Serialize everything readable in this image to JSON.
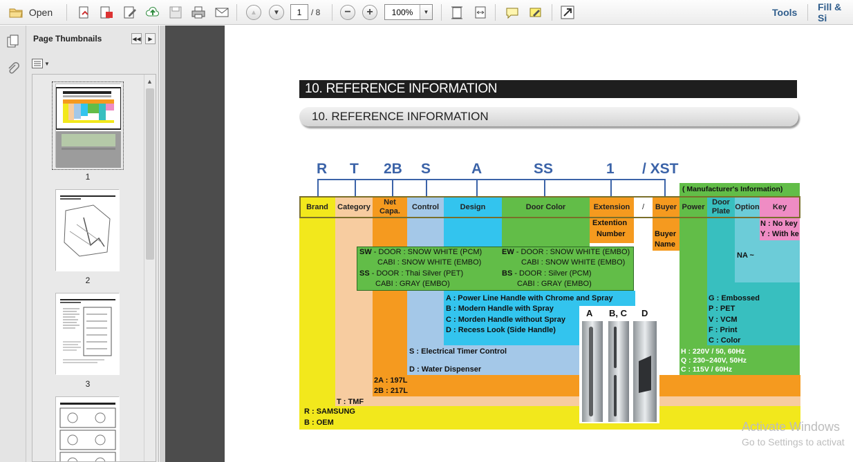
{
  "toolbar": {
    "open_label": "Open",
    "page_current": "1",
    "page_total": "/ 8",
    "zoom": "100%",
    "tools_label": "Tools",
    "fill_sign_label": "Fill & Si"
  },
  "sidebar": {
    "title": "Page Thumbnails",
    "thumbnails": [
      "1",
      "2",
      "3"
    ]
  },
  "document": {
    "band_title": "10. REFERENCE INFORMATION",
    "pill_title": "10. REFERENCE INFORMATION",
    "model_code": [
      "R",
      "T",
      "2B",
      "S",
      "A",
      "SS",
      "1",
      "/ XST"
    ],
    "manufacturer_info": "( Manufacturer's Information)",
    "headers": {
      "brand": "Brand",
      "category": "Category",
      "net_capa_1": "Net",
      "net_capa_2": "Capa.",
      "control": "Control",
      "design": "Design",
      "door_color": "Door Color",
      "extension": "Extension",
      "slash": "/",
      "buyer": "Buyer",
      "power": "Power",
      "door_plate_1": "Door",
      "door_plate_2": "Plate",
      "option": "Option",
      "key": "Key"
    },
    "extension_number": [
      "Extention",
      "Number"
    ],
    "buyer_name": [
      "Buyer",
      "Name"
    ],
    "key_values": [
      "N : No key",
      "Y : With ke"
    ],
    "option_value": "NA ~",
    "door_color_lines": [
      {
        "code": "SW",
        "text": " - DOOR : SNOW WHITE (PCM)"
      },
      {
        "code": "",
        "text": "CABI : SNOW WHITE (EMBO)"
      },
      {
        "code": "SS",
        "text": " - DOOR : Thai Silver (PET)"
      },
      {
        "code": "",
        "text": "CABI : GRAY (EMBO)"
      },
      {
        "code": "EW",
        "text": " - DOOR : SNOW WHITE (EMBO)"
      },
      {
        "code": "",
        "text": "CABI : SNOW WHITE (EMBO)"
      },
      {
        "code": "BS",
        "text": " - DOOR : Silver (PCM)"
      },
      {
        "code": "",
        "text": "CABI : GRAY (EMBO)"
      }
    ],
    "design_values": [
      "A : Power Line Handle with Chrome and Spray",
      "B : Modern Handle with Spray",
      "C : Morden Handle without Spray",
      "D : Recess Look (Side Handle)"
    ],
    "handle_labels": [
      "A",
      "B, C",
      "D"
    ],
    "control_values": [
      "S : Electrical Timer Control",
      "D : Water Dispenser"
    ],
    "door_plate_values": [
      "G : Embossed",
      "P : PET",
      "V : VCM",
      "F : Print",
      "C : Color"
    ],
    "power_values": [
      "H : 220V / 50, 60Hz",
      "Q : 230~240V, 50Hz",
      "C : 115V / 60Hz"
    ],
    "capacity_values": [
      "2A : 197L",
      "2B : 217L"
    ],
    "category_values": [
      "T : TMF"
    ],
    "brand_values": [
      "R : SAMSUNG",
      "B : OEM"
    ]
  },
  "watermark": {
    "line1": "Activate Windows",
    "line2": "Go to Settings to activat"
  },
  "colors": {
    "brand": "#f2e81c",
    "category": "#f7cca0",
    "capacity": "#f59a1f",
    "control": "#a4c8e8",
    "design": "#33c4ee",
    "door_color": "#62bd48",
    "extension": "#f59a1f",
    "power": "#62bd48",
    "door_plate": "#38bfbf",
    "option": "#6cccd8",
    "key": "#ef8cc4",
    "code_blue": "#3b63a8"
  }
}
